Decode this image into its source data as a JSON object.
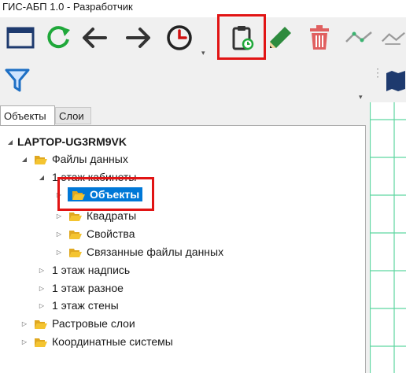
{
  "window": {
    "title": "ГИС-АБП 1.0 - Разработчик"
  },
  "toolbar": {
    "buttons": [
      {
        "icon": "window-icon"
      },
      {
        "icon": "refresh-icon"
      },
      {
        "icon": "arrow-left-icon"
      },
      {
        "icon": "arrow-right-icon"
      },
      {
        "icon": "clock-icon"
      },
      {
        "icon": "clipboard-clock-icon",
        "highlighted": true
      },
      {
        "icon": "pencil-icon"
      },
      {
        "icon": "trash-icon"
      },
      {
        "icon": "line-tool-icon"
      }
    ]
  },
  "toolbar2": {
    "buttons": [
      {
        "icon": "filter-icon"
      }
    ]
  },
  "tabs": [
    {
      "label": "Объекты",
      "active": true
    },
    {
      "label": "Слои",
      "active": false
    }
  ],
  "tree": {
    "root": {
      "label": "LAPTOP-UG3RM9VK"
    },
    "data_files": {
      "label": "Файлы данных"
    },
    "floor1_offices": {
      "label": "1 этаж кабинеты"
    },
    "objects": {
      "label": "Объекты",
      "selected": true
    },
    "squares": {
      "label": "Квадраты"
    },
    "properties": {
      "label": "Свойства"
    },
    "linked_files": {
      "label": "Связанные файлы данных"
    },
    "floor1_label": {
      "label": "1 этаж надпись"
    },
    "floor1_misc": {
      "label": "1 этаж разное"
    },
    "floor1_walls": {
      "label": "1 этаж стены"
    },
    "raster_layers": {
      "label": "Растровые слои"
    },
    "coord_systems": {
      "label": "Координатные системы"
    }
  },
  "colors": {
    "accent_selection": "#0078d7",
    "highlight_box": "#e11414",
    "refresh_green": "#1fa83a",
    "pencil_green": "#2e8b3e",
    "trash_red": "#e06060",
    "folder_yellow": "#f4c430",
    "filter_blue": "#1e6fc4",
    "grid_green": "#5ed6a0"
  }
}
